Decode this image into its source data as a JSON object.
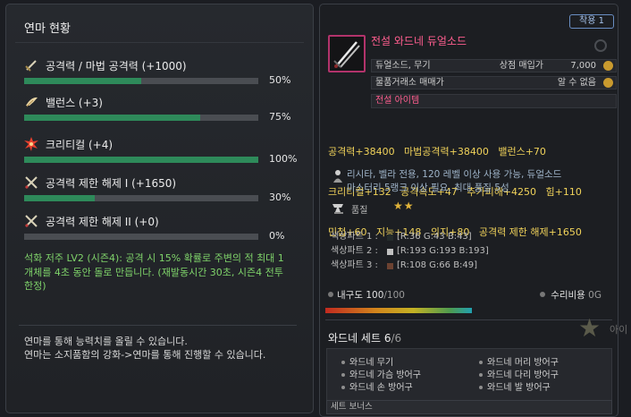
{
  "enhance_panel": {
    "title": "연마 현황",
    "stats": [
      {
        "icon": "sword-icon",
        "label": "공격력 / 마법 공격력 (+1000)",
        "progress": 0.5,
        "percent": "50%"
      },
      {
        "icon": "feather-wing-icon",
        "label": "밸런스 (+3)",
        "progress": 0.75,
        "percent": "75%"
      },
      {
        "icon": "critical-burst-icon",
        "label": "크리티컬 (+4)",
        "progress": 1.0,
        "percent": "100%"
      },
      {
        "icon": "crossed-swords-icon",
        "label": "공격력 제한 해제 I (+1650)",
        "progress": 0.3,
        "percent": "30%"
      },
      {
        "icon": "crossed-swords-icon",
        "label": "공격력 제한 해제 II (+0)",
        "progress": 0.0,
        "percent": "0%"
      }
    ],
    "curse_text": "석화 저주 LV2 (시즌4): 공격 시 15% 확률로 주변의 적 최대 1개체를 4초 동안 돌로 만듭니다. (재발동시간 30초, 시즌4 전투 한정)",
    "footer_line1": "연마를 통해 능력치를 올릴 수 있습니다.",
    "footer_line2": "연마는 소지품함의 강화->연마를 통해 진행할 수 있습니다."
  },
  "item_tooltip": {
    "equipped_badge": "착용 1",
    "name": "전설 와드네 듀얼소드",
    "category": "듀얼소드, 무기",
    "shop_price_label": "상점 매입가",
    "shop_price": "7,000",
    "trade_label": "물품거래소 매매가",
    "trade_value": "알 수 없음",
    "item_type": "전설 아이템",
    "stat_lines": [
      "공격력+38400   마법공격력+38400   밸런스+70",
      "크리티컬+132   공격속도+47   추가피해+4250   힘+110",
      "민첩+60   지능+148   의지+80   공격력 제한 해제+1650"
    ],
    "desc_line1": "리시타, 벨라 전용, 120 레벨 이상 사용 가능, 듀얼소드",
    "desc_line2": "마스터리 5랭크 이상 필요, 최대 품질 5성",
    "grade_label": "품질",
    "grade_stars": "★★",
    "color_parts": [
      {
        "label": "색상파트 1 :",
        "swatch": "#242b2b",
        "value": "[R:36 G:43 B:43]"
      },
      {
        "label": "색상파트 2 :",
        "swatch": "#c1c1c1",
        "value": "[R:193 G:193 B:193]"
      },
      {
        "label": "색상파트 3 :",
        "swatch": "#6c4231",
        "value": "[R:108 G:66 B:49]"
      }
    ],
    "durability_label": "내구도",
    "durability_current": "100",
    "durability_max": "/100",
    "repair_label": "수리비용",
    "repair_value": "0G",
    "set_name": "와드네 세트",
    "set_count": "6",
    "set_count_max": "/6",
    "set_items": [
      "와드네 무기",
      "와드네 머리 방어구",
      "와드네 가슴 방어구",
      "와드네 다리 방어구",
      "와드네 손 방어구",
      "와드네 발 방어구"
    ],
    "set_bonus_label": "세트 보너스"
  },
  "background": {
    "right_edge_text": "아이"
  },
  "colors": {
    "progress_fill": "#2e8a5a",
    "legendary_pink": "#ff5e8f",
    "stat_yellow": "#f0d25a",
    "curse_green": "#7fd36a"
  }
}
